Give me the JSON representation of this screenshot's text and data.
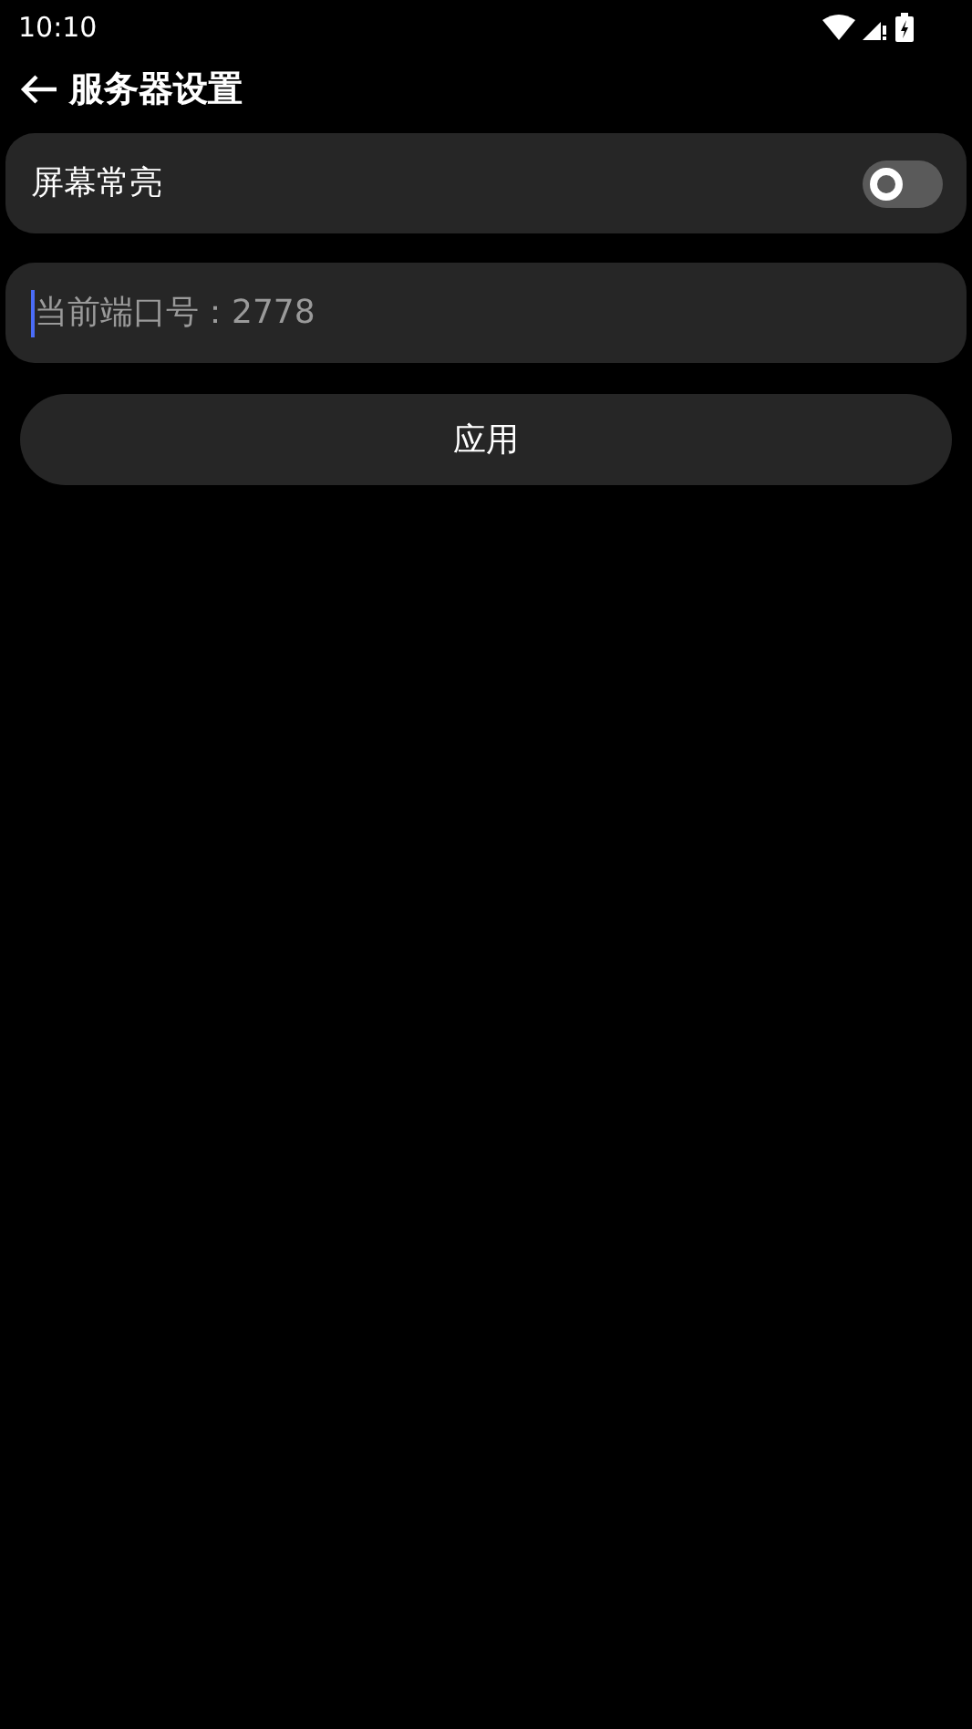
{
  "status_bar": {
    "time": "10:10"
  },
  "header": {
    "title": "服务器设置"
  },
  "settings": [
    {
      "kind": "toggle",
      "label": "屏幕常亮",
      "on": false
    }
  ],
  "port_field": {
    "placeholder": "当前端口号：2778",
    "focused": true
  },
  "apply_button": {
    "label": "应用"
  }
}
